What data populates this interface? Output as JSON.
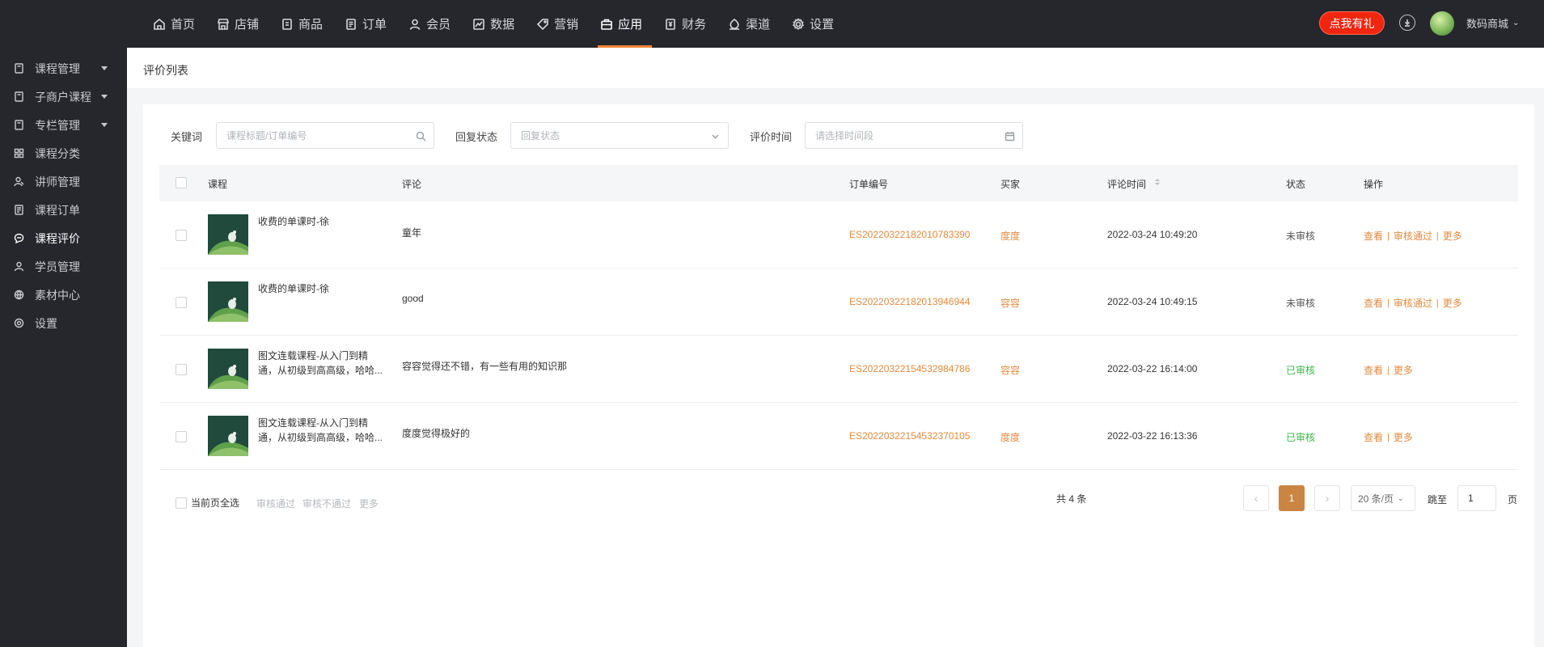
{
  "topnav": [
    {
      "label": "首页",
      "icon": "home-icon"
    },
    {
      "label": "店铺",
      "icon": "store-icon"
    },
    {
      "label": "商品",
      "icon": "product-icon"
    },
    {
      "label": "订单",
      "icon": "order-icon"
    },
    {
      "label": "会员",
      "icon": "user-icon"
    },
    {
      "label": "数据",
      "icon": "chart-icon"
    },
    {
      "label": "营销",
      "icon": "tag-icon"
    },
    {
      "label": "应用",
      "icon": "briefcase-icon",
      "active": true
    },
    {
      "label": "财务",
      "icon": "finance-icon"
    },
    {
      "label": "渠道",
      "icon": "channel-icon"
    },
    {
      "label": "设置",
      "icon": "gear-icon"
    }
  ],
  "header": {
    "gift_label": "点我有礼",
    "shop_name": "数码商城"
  },
  "sidebar": [
    {
      "label": "课程管理",
      "icon": "book-icon",
      "caret": true
    },
    {
      "label": "子商户课程",
      "icon": "book-icon",
      "caret": true
    },
    {
      "label": "专栏管理",
      "icon": "book-icon",
      "caret": true
    },
    {
      "label": "课程分类",
      "icon": "grid-icon"
    },
    {
      "label": "讲师管理",
      "icon": "teacher-icon"
    },
    {
      "label": "课程订单",
      "icon": "list-icon"
    },
    {
      "label": "课程评价",
      "icon": "comment-icon",
      "active": true
    },
    {
      "label": "学员管理",
      "icon": "user-icon"
    },
    {
      "label": "素材中心",
      "icon": "globe-icon"
    },
    {
      "label": "设置",
      "icon": "gear-icon"
    }
  ],
  "page": {
    "title": "评价列表"
  },
  "filters": {
    "keyword_label": "关键词",
    "keyword_placeholder": "课程标题/订单编号",
    "reply_label": "回复状态",
    "reply_placeholder": "回复状态",
    "time_label": "评价时间",
    "time_placeholder": "请选择时间段"
  },
  "table": {
    "columns": [
      "课程",
      "评论",
      "订单编号",
      "买家",
      "评论时间",
      "状态",
      "操作"
    ],
    "rows": [
      {
        "course_l1": "收费的单课时-徐",
        "course_l2": "",
        "comment": "童年",
        "order": "ES2022032218201078339​0",
        "buyer": "度度",
        "time": "2022-03-24 10:49:20",
        "status": "未审核",
        "status_type": "pending",
        "ops": [
          "查看",
          "审核通过",
          "更多"
        ]
      },
      {
        "course_l1": "收费的单课时-徐",
        "course_l2": "",
        "comment": "good",
        "order": "ES20220322182013946944",
        "buyer": "容容",
        "time": "2022-03-24 10:49:15",
        "status": "未审核",
        "status_type": "pending",
        "ops": [
          "查看",
          "审核通过",
          "更多"
        ]
      },
      {
        "course_l1": "图文连载课程-从入门到精",
        "course_l2": "通，从初级到高高级，哈哈...",
        "comment": "容容觉得还不错，有一些有用的知识那",
        "order": "ES20220322154532984786",
        "buyer": "容容",
        "time": "2022-03-22 16:14:00",
        "status": "已审核",
        "status_type": "done",
        "ops": [
          "查看",
          "更多"
        ]
      },
      {
        "course_l1": "图文连载课程-从入门到精",
        "course_l2": "通，从初级到高高级，哈哈...",
        "comment": "度度觉得极好的",
        "order": "ES20220322154532370105",
        "buyer": "度度",
        "time": "2022-03-22 16:13:36",
        "status": "已审核",
        "status_type": "done",
        "ops": [
          "查看",
          "更多"
        ]
      }
    ]
  },
  "footer": {
    "select_all": "当前页全选",
    "bulk_actions": [
      "审核通过",
      "审核不通过",
      "更多"
    ]
  },
  "pagination": {
    "total": "共 4 条",
    "current": "1",
    "page_size": "20 条/页",
    "goto_label": "跳至",
    "goto_value": "1",
    "page_suffix": "页"
  },
  "colors": {
    "accent": "#e28a3f",
    "active_tab": "#f0863a",
    "gift": "#f0260f",
    "approved": "#3bb54a",
    "dark_bg": "#25272c"
  }
}
